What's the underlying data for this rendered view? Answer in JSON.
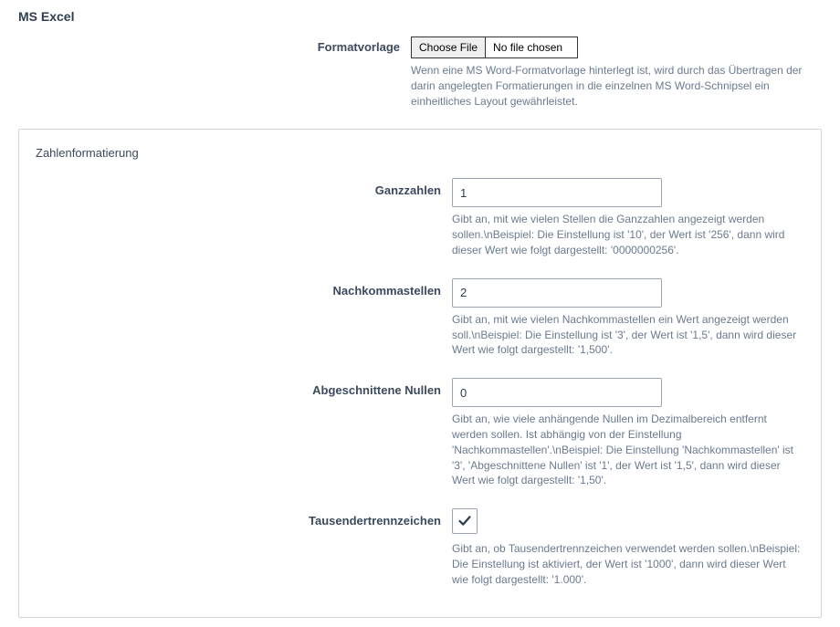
{
  "section": {
    "title": "MS Excel"
  },
  "formatvorlage": {
    "label": "Formatvorlage",
    "choose_button": "Choose File",
    "no_file_text": "No file chosen",
    "help": "Wenn eine MS Word-Formatvorlage hinterlegt ist, wird durch das Übertragen der darin angelegten Formatierungen in die einzelnen MS Word-Schnipsel ein einheitliches Layout gewährleistet."
  },
  "fieldset": {
    "legend": "Zahlenformatierung",
    "ganzzahlen": {
      "label": "Ganzzahlen",
      "value": "1",
      "help": "Gibt an, mit wie vielen Stellen die Ganzzahlen angezeigt werden sollen.\\nBeispiel: Die Einstellung ist '10', der Wert ist '256', dann wird dieser Wert wie folgt dargestellt: '0000000256'."
    },
    "nachkommastellen": {
      "label": "Nachkommastellen",
      "value": "2",
      "help": "Gibt an, mit wie vielen Nachkommastellen ein Wert angezeigt werden soll.\\nBeispiel: Die Einstellung ist '3', der Wert ist '1,5', dann wird dieser Wert wie folgt dargestellt: '1,500'."
    },
    "abgeschnittene_nullen": {
      "label": "Abgeschnittene Nullen",
      "value": "0",
      "help": "Gibt an, wie viele anhängende Nullen im Dezimalbereich entfernt werden sollen. Ist abhängig von der Einstellung 'Nachkommastellen'.\\nBeispiel: Die Einstellung 'Nachkommastellen' ist '3', 'Abgeschnittene Nullen' ist '1', der Wert ist '1,5', dann wird dieser Wert wie folgt dargestellt: '1,50'."
    },
    "tausendertrennzeichen": {
      "label": "Tausendertrennzeichen",
      "checked": true,
      "help": "Gibt an, ob Tausendertrennzeichen verwendet werden sollen.\\nBeispiel: Die Einstellung ist aktiviert, der Wert ist '1000', dann wird dieser Wert wie folgt dargestellt: '1.000'."
    }
  }
}
